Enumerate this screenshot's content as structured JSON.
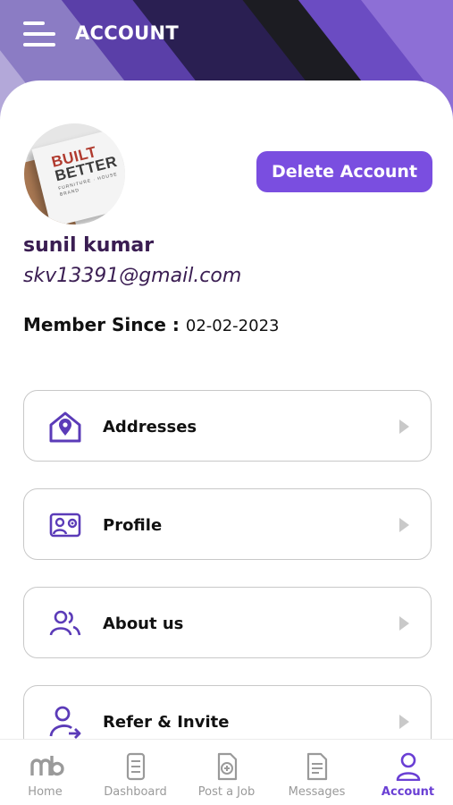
{
  "header": {
    "title": "ACCOUNT"
  },
  "profile": {
    "avatar_text_line1": "BUILT",
    "avatar_text_line2": "BETTER",
    "avatar_text_sub": "FURNITURE · HOUSE BRAND",
    "name": "sunil kumar",
    "email": "skv13391@gmail.com",
    "member_since_label": "Member Since :",
    "member_since_date": "02-02-2023",
    "delete_label": "Delete Account"
  },
  "menu": [
    {
      "label": "Addresses",
      "icon": "address-home-icon"
    },
    {
      "label": "Profile",
      "icon": "profile-card-icon"
    },
    {
      "label": "About us",
      "icon": "users-icon"
    },
    {
      "label": "Refer & Invite",
      "icon": "refer-user-icon"
    }
  ],
  "bottom_nav": [
    {
      "label": "Home",
      "icon": "mb-logo-icon"
    },
    {
      "label": "Dashboard",
      "icon": "dashboard-icon"
    },
    {
      "label": "Post a Job",
      "icon": "post-job-icon"
    },
    {
      "label": "Messages",
      "icon": "messages-icon"
    },
    {
      "label": "Account",
      "icon": "account-icon",
      "active": true
    }
  ],
  "colors": {
    "accent": "#7a4ee0",
    "icon": "#5b3bb8",
    "nav_active": "#6a3fd4",
    "text_dark": "#3a1d52"
  }
}
